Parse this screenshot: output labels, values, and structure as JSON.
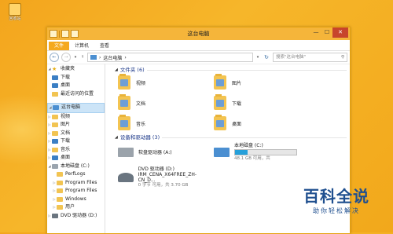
{
  "desktop": {
    "icon_label": "回收站"
  },
  "window": {
    "title": "这台电脑",
    "controls": {
      "minimize": "—",
      "maximize": "☐",
      "close": "✕"
    }
  },
  "ribbon": {
    "tabs": [
      "文件",
      "计算机",
      "查看"
    ]
  },
  "addressbar": {
    "back": "←",
    "forward": "→",
    "up": "↑",
    "path": [
      "这台电脑"
    ],
    "search_placeholder": "搜索\"这台电脑\""
  },
  "nav": {
    "favorites": {
      "label": "收藏夹",
      "items": [
        "下载",
        "桌面",
        "最近访问的位置"
      ]
    },
    "this_pc": {
      "label": "这台电脑",
      "items": [
        "视频",
        "图片",
        "文档",
        "下载",
        "音乐",
        "桌面"
      ]
    },
    "drive": {
      "label": "本地磁盘 (C:)",
      "items": [
        "PerfLogs",
        "Program Files",
        "Program Files",
        "Windows",
        "用户"
      ]
    },
    "dvd": {
      "label": "DVD 驱动器 (D:)"
    }
  },
  "content": {
    "folders_header": "文件夹 (6)",
    "folders": [
      {
        "label": "视频"
      },
      {
        "label": "图片"
      },
      {
        "label": "文档"
      },
      {
        "label": "下载"
      },
      {
        "label": "音乐"
      },
      {
        "label": "桌面"
      }
    ],
    "devices_header": "设备和驱动器 (3)",
    "devices": [
      {
        "label": "软盘驱动器 (A:)"
      },
      {
        "label": "本地磁盘 (C:)",
        "free": "48.1 GB 可用，共",
        "used_fraction": 0.2
      },
      {
        "label": "DVD 驱动器 (D:)",
        "sub": "IRM_CENA_X64FREE_ZH-CN_D...",
        "free": "0 字节 可用，共 3.70 GB"
      }
    ]
  },
  "watermark": {
    "title": "百科全说",
    "subtitle": "助你轻松解决"
  },
  "colors": {
    "accent": "#f5b53a",
    "progress": "#26a0da",
    "selection": "#cce4f7"
  }
}
